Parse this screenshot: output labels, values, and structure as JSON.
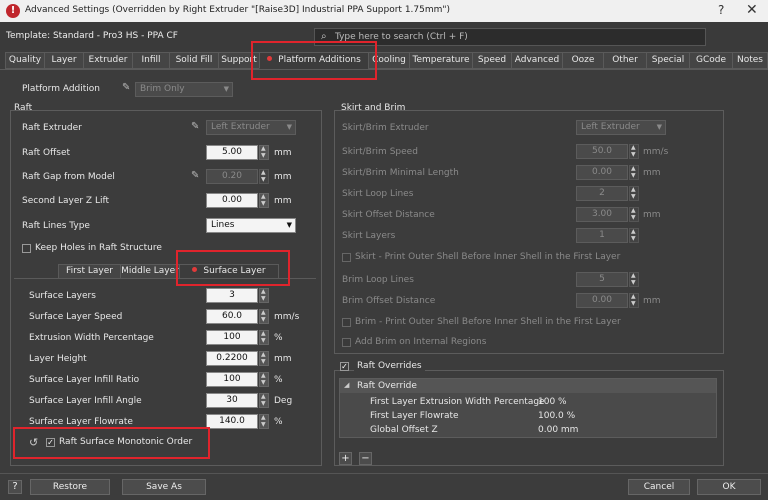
{
  "window": {
    "title": "Advanced Settings (Overridden by Right Extruder \"[Raise3D] Industrial PPA Support 1.75mm\")",
    "help": "?",
    "close": "✕"
  },
  "template": {
    "label": "Template: Standard - Pro3 HS - PPA CF",
    "search_placeholder": "Type here to search (Ctrl + F)"
  },
  "tabs": [
    "Quality",
    "Layer",
    "Extruder",
    "Infill",
    "Solid Fill",
    "Support",
    "Platform Additions",
    "Cooling",
    "Temperature",
    "Speed",
    "Advanced",
    "Ooze",
    "Other",
    "Special",
    "GCode",
    "Notes"
  ],
  "active_tab": "Platform Additions",
  "platform_addition": {
    "label": "Platform Addition",
    "value": "Brim Only"
  },
  "raft": {
    "group_label": "Raft",
    "extruder": {
      "label": "Raft Extruder",
      "value": "Left Extruder"
    },
    "offset": {
      "label": "Raft Offset",
      "value": "5.00",
      "unit": "mm"
    },
    "gap": {
      "label": "Raft Gap from Model",
      "value": "0.20",
      "unit": "mm"
    },
    "second_layer": {
      "label": "Second Layer Z Lift",
      "value": "0.00",
      "unit": "mm"
    },
    "lines_type": {
      "label": "Raft Lines Type",
      "value": "Lines"
    },
    "keep_holes": {
      "label": "Keep Holes in Raft Structure",
      "checked": false
    },
    "subtabs": [
      "First Layer",
      "Middle Layer",
      "Surface Layer"
    ],
    "active_subtab": "Surface Layer",
    "surface": [
      {
        "label": "Surface Layers",
        "value": "3",
        "unit": ""
      },
      {
        "label": "Surface Layer Speed",
        "value": "60.0",
        "unit": "mm/s"
      },
      {
        "label": "Extrusion Width Percentage",
        "value": "100",
        "unit": "%"
      },
      {
        "label": "Layer Height",
        "value": "0.2200",
        "unit": "mm"
      },
      {
        "label": "Surface Layer Infill Ratio",
        "value": "100",
        "unit": "%"
      },
      {
        "label": "Surface Layer Infill Angle",
        "value": "30",
        "unit": "Deg"
      },
      {
        "label": "Surface Layer Flowrate",
        "value": "140.0",
        "unit": "%"
      }
    ],
    "monotonic": {
      "label": "Raft Surface Monotonic Order",
      "checked": true
    }
  },
  "skirt": {
    "group_label": "Skirt and Brim",
    "extruder": {
      "label": "Skirt/Brim Extruder",
      "value": "Left Extruder"
    },
    "speed": {
      "label": "Skirt/Brim Speed",
      "value": "50.0",
      "unit": "mm/s"
    },
    "min_length": {
      "label": "Skirt/Brim Minimal Length",
      "value": "0.00",
      "unit": "mm"
    },
    "loop_lines": {
      "label": "Skirt Loop Lines",
      "value": "2"
    },
    "offset_distance": {
      "label": "Skirt Offset Distance",
      "value": "3.00",
      "unit": "mm"
    },
    "layers": {
      "label": "Skirt Layers",
      "value": "1"
    },
    "print_outer_skirt": {
      "label": "Skirt - Print Outer Shell Before Inner Shell in the First Layer",
      "checked": false
    },
    "brim_loop_lines": {
      "label": "Brim Loop Lines",
      "value": "5"
    },
    "brim_offset": {
      "label": "Brim Offset Distance",
      "value": "0.00",
      "unit": "mm"
    },
    "print_outer_brim": {
      "label": "Brim - Print Outer Shell Before Inner Shell in the First Layer",
      "checked": false
    },
    "internal_regions": {
      "label": "Add Brim on Internal Regions",
      "checked": false
    }
  },
  "raft_overrides": {
    "label": "Raft Overrides",
    "checked": true,
    "header": "Raft Override",
    "rows": [
      {
        "name": "First Layer Extrusion Width Percentage",
        "value": "100 %"
      },
      {
        "name": "First Layer Flowrate",
        "value": "100.0 %"
      },
      {
        "name": "Global Offset Z",
        "value": "0.00 mm"
      }
    ],
    "add": "+",
    "remove": "−"
  },
  "footer": {
    "help": "?",
    "restore": "Restore",
    "save_as": "Save As",
    "cancel": "Cancel",
    "ok": "OK"
  }
}
